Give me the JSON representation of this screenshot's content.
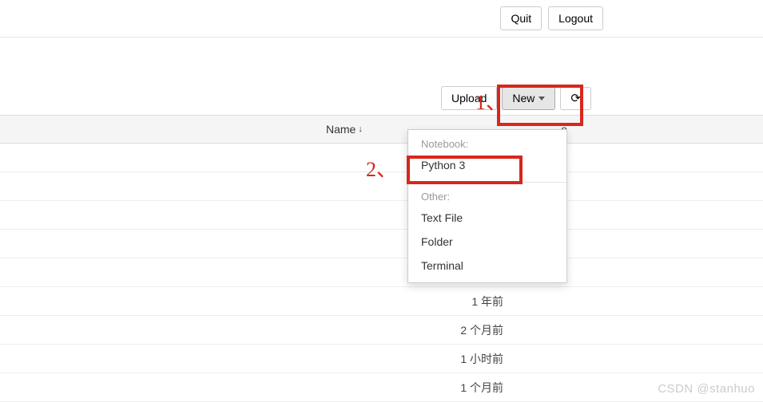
{
  "topbar": {
    "quit": "Quit",
    "logout": "Logout"
  },
  "toolbar": {
    "upload": "Upload",
    "new": "New"
  },
  "header": {
    "name": "Name",
    "size_suffix": "e"
  },
  "dropdown": {
    "notebook_label": "Notebook:",
    "python3": "Python 3",
    "other_label": "Other:",
    "text_file": "Text File",
    "folder": "Folder",
    "terminal": "Terminal"
  },
  "rows": {
    "r1": "1 年前",
    "r2": "2 个月前",
    "r3": "1 小时前",
    "r4": "1 个月前"
  },
  "annotations": {
    "one": "1、",
    "two": "2、"
  },
  "watermark": "CSDN @stanhuo"
}
